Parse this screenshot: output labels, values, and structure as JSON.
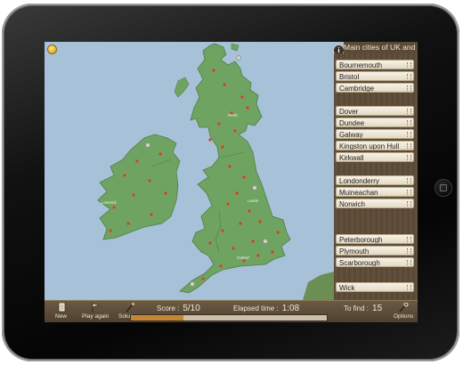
{
  "game": {
    "title": "Main cities of UK and Ireland",
    "info_symbol": "i",
    "city_buttons": [
      "Bournemouth",
      "Bristol",
      "Cambridge",
      "Dover",
      "Dundee",
      "Galway",
      "Kingston upon Hull",
      "Kirkwall",
      "Londonderry",
      "Muineachan",
      "Norwich",
      "Peterborough",
      "Plymouth",
      "Scarborough",
      "Wick"
    ],
    "map_labels": [
      "Perth",
      "Leeds",
      "Oxford",
      "Limerick"
    ]
  },
  "toolbar": {
    "new_label": "New",
    "play_again_label": "Play again",
    "solutions_label": "Solutions",
    "options_label": "Options",
    "score_label": "Score :",
    "score_value": "5/10",
    "elapsed_label": "Elapsed time :",
    "elapsed_value": "1:08",
    "to_find_label": "To find :",
    "to_find_value": "15",
    "progress_fraction": 0.27
  },
  "icons": {
    "new": "document-icon",
    "play_again": "flag-icon",
    "solutions": "wand-icon",
    "options": "wrench-icon",
    "hint": "lightbulb-icon",
    "info": "info-icon"
  },
  "colors": {
    "sea": "#a7c1d8",
    "land": "#6fa361",
    "panel": "#5a4a37",
    "marker": "#e33b22"
  }
}
